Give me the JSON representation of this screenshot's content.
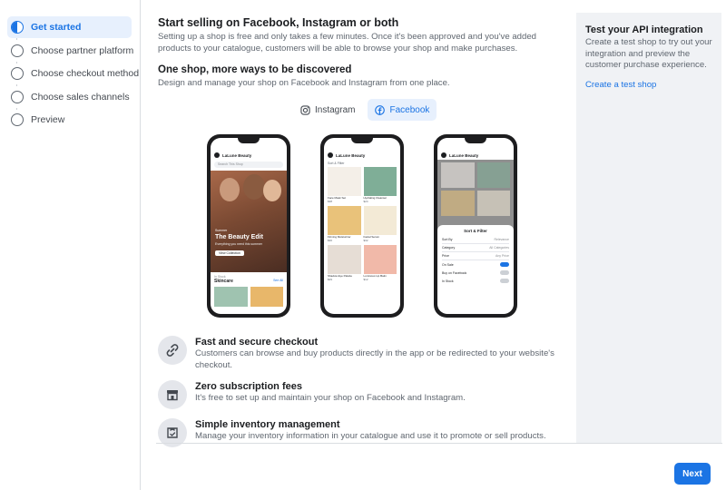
{
  "sidebar": {
    "steps": [
      {
        "label": "Get started",
        "active": true
      },
      {
        "label": "Choose partner platform",
        "active": false
      },
      {
        "label": "Choose checkout method",
        "active": false
      },
      {
        "label": "Choose sales channels",
        "active": false
      },
      {
        "label": "Preview",
        "active": false
      }
    ]
  },
  "main": {
    "title": "Start selling on Facebook, Instagram or both",
    "intro": "Setting up a shop is free and only takes a few minutes. Once it's been approved and you've added products to your catalogue, customers will be able to browse your shop and make purchases.",
    "subtitle": "One shop, more ways to be discovered",
    "subtitle_desc": "Design and manage your shop on Facebook and Instagram from one place.",
    "toggle": {
      "instagram": "Instagram",
      "facebook": "Facebook",
      "selected": "facebook"
    },
    "phones": {
      "brand": "LaLune Beauty",
      "search": "Search This Shop",
      "hero_small": "Summer",
      "hero_title": "The Beauty Edit",
      "hero_sub": "Everything you need this summer",
      "hero_button": "View Collection",
      "section_small": "In Stock",
      "section": "Skincare",
      "see_all": "See All",
      "sort_filter": "Sort & Filter",
      "products": [
        {
          "name": "Face Mask Set",
          "price": "$38"
        },
        {
          "name": "Hydrating Cleanser",
          "price": "$24"
        },
        {
          "name": "Firming Moisturizer",
          "price": "$36"
        },
        {
          "name": "Facial Serum",
          "price": "$32"
        },
        {
          "name": "Shadow Eye Palette",
          "price": "$29"
        },
        {
          "name": "Luminous Lip Balm",
          "price": "$12"
        }
      ],
      "filter_title": "Sort & Filter",
      "filters": [
        {
          "label": "Sort By",
          "value": "Relevance"
        },
        {
          "label": "Category",
          "value": "All Categories"
        },
        {
          "label": "Price",
          "value": "Any Price"
        }
      ],
      "toggles": [
        {
          "label": "On Sale",
          "on": true
        },
        {
          "label": "Buy on Facebook",
          "on": false
        },
        {
          "label": "In Stock",
          "on": false
        }
      ]
    },
    "features": [
      {
        "icon": "link-icon",
        "title": "Fast and secure checkout",
        "desc": "Customers can browse and buy products directly in the app or be redirected to your website's checkout."
      },
      {
        "icon": "storefront-icon",
        "title": "Zero subscription fees",
        "desc": "It's free to set up and maintain your shop on Facebook and Instagram."
      },
      {
        "icon": "inventory-icon",
        "title": "Simple inventory management",
        "desc": "Manage your inventory information in your catalogue and use it to promote or sell products."
      }
    ]
  },
  "right_panel": {
    "title": "Test your API integration",
    "desc": "Create a test shop to try out your integration and preview the customer purchase experience.",
    "link": "Create a test shop"
  },
  "footer": {
    "next": "Next"
  },
  "colors": {
    "accent": "#1b74e4",
    "panel": "#f0f2f5"
  }
}
